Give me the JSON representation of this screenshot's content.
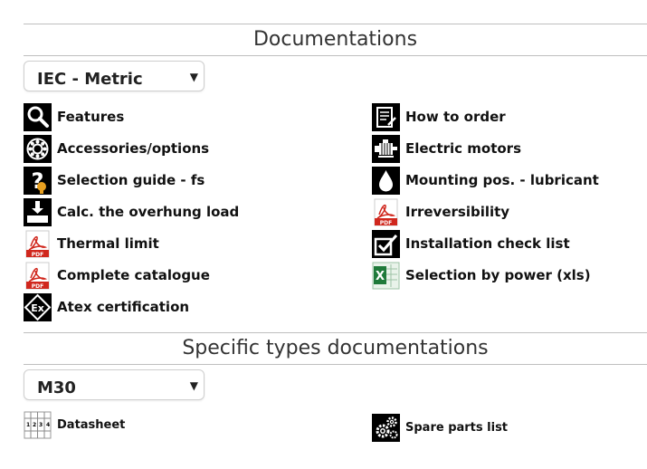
{
  "documentations": {
    "title": "Documentations",
    "select_value": "IEC - Metric",
    "left_items": [
      {
        "label": "Features",
        "icon": "magnifier-icon"
      },
      {
        "label": "Accessories/options",
        "icon": "bearing-icon"
      },
      {
        "label": "Selection guide - fs",
        "icon": "question-icon"
      },
      {
        "label": "Calc. the overhung load",
        "icon": "overhung-load-icon"
      },
      {
        "label": "Thermal limit",
        "icon": "pdf-icon"
      },
      {
        "label": "Complete catalogue",
        "icon": "pdf-icon"
      },
      {
        "label": "Atex certification",
        "icon": "atex-icon"
      }
    ],
    "right_items": [
      {
        "label": "How to order",
        "icon": "order-form-icon"
      },
      {
        "label": "Electric motors",
        "icon": "electric-motor-icon"
      },
      {
        "label": "Mounting pos. - lubricant",
        "icon": "oil-drop-icon"
      },
      {
        "label": "Irreversibility",
        "icon": "pdf-icon"
      },
      {
        "label": "Installation check list",
        "icon": "checklist-icon"
      },
      {
        "label": "Selection by power (xls)",
        "icon": "excel-icon"
      }
    ]
  },
  "specific": {
    "title": "Specific types documentations",
    "select_value": "M30",
    "left_items": [
      {
        "label": "Datasheet",
        "icon": "datasheet-icon"
      }
    ],
    "right_items": [
      {
        "label": "Spare parts list",
        "icon": "gears-icon"
      }
    ]
  },
  "colors": {
    "icon_black": "#000000",
    "pdf_red": "#d0271d",
    "excel_green": "#1f7a3a",
    "rule_gray": "#bfbfbf"
  }
}
